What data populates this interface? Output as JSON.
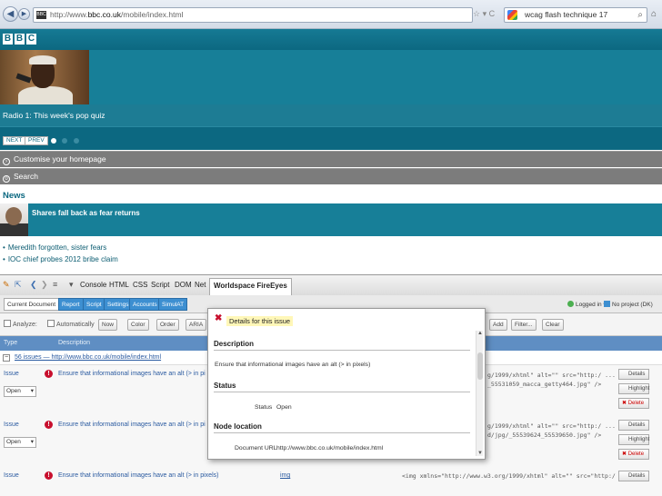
{
  "browser": {
    "url_prefix": "http://www.",
    "url_domain": "bbc.co.uk",
    "url_path": "/mobile/index.html",
    "search_text": "wcag flash technique 17",
    "url_icons": "☆ ▾ C"
  },
  "bbc": {
    "logo": [
      "B",
      "B",
      "C"
    ],
    "promo_caption": "Radio 1: This week's pop quiz",
    "next_label": "NEXT",
    "prev_label": "PREV",
    "menu": [
      "Customise your homepage",
      "Search"
    ],
    "news_title": "News",
    "news_headline": "Shares fall back as fear returns",
    "bullets": [
      "Meredith forgotten, sister fears",
      "IOC chief probes 2012 bribe claim"
    ]
  },
  "firebug": {
    "tabs": [
      "Console",
      "HTML",
      "CSS",
      "Script",
      "DOM",
      "Net",
      "Worldspace FireEyes"
    ],
    "fe_tabs": [
      "Current Document",
      "Report",
      "Script",
      "Settings",
      "Accounts",
      "SimulAT"
    ],
    "logged_in": "Logged in ▾",
    "no_project": "No project (DK)",
    "analyze": {
      "label": "Analyze:",
      "automatic": "Automatically",
      "now": "Now",
      "color": "Color",
      "order": "Order",
      "aria": "ARIA",
      "add": "Add",
      "filter": "Filter...",
      "clear": "Clear"
    },
    "columns": {
      "type": "Type",
      "description": "Description"
    },
    "issues_url": "56 issues — http://www.bbc.co.uk/mobile/index.html",
    "issues": [
      {
        "type": "Issue",
        "status": "Open",
        "description": "Ensure that informational images have an alt (> in pi",
        "code": "g/1999/xhtml\" alt=\"\" src=\"http:/ ...\n_55531059_macca_getty464.jpg\" />"
      },
      {
        "type": "Issue",
        "status": "Open",
        "description": "Ensure that informational images have an alt (> in pi",
        "code": "g/1999/xhtml\" alt=\"\" src=\"http:/ ...\nd/jpg/_55539624_55539650.jpg\" />"
      }
    ],
    "last_issue": {
      "type": "Issue",
      "description": "Ensure that informational images have an alt (> in pixels)",
      "element": "img",
      "code": "<img xmlns=\"http://www.w3.org/1999/xhtml\" alt=\"\" src=\"http:/"
    },
    "row_buttons": {
      "details": "Details",
      "highlight": "Highlight",
      "delete": "Delete"
    }
  },
  "popup": {
    "title": "Details for this issue",
    "description_header": "Description",
    "description_text": "Ensure that informational images have an alt (> in pixels)",
    "status_header": "Status",
    "status_label": "Status",
    "status_value": "Open",
    "node_header": "Node location",
    "doc_url_label": "Document URL",
    "doc_url_value": "http://www.bbc.co.uk/mobile/index.html"
  }
}
